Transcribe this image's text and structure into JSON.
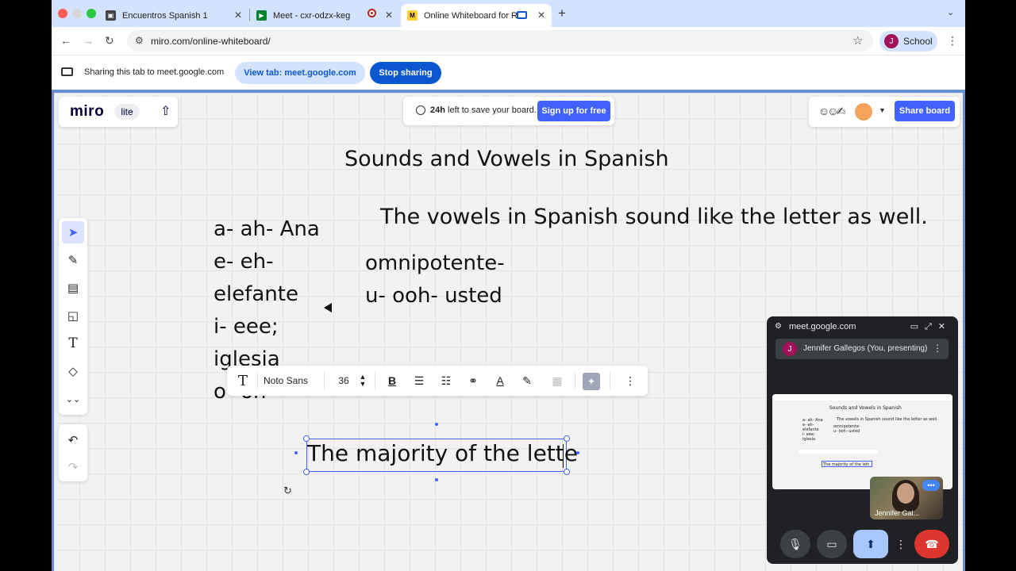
{
  "browser": {
    "tabs": [
      {
        "title": "Encuentros Spanish 1"
      },
      {
        "title": "Meet - cxr-odzx-keg"
      },
      {
        "title": "Online Whiteboard for Re"
      }
    ],
    "new_tab": "+",
    "tab_menu": "⌄",
    "url": "miro.com/online-whiteboard/",
    "profile_initial": "J",
    "profile_label": "School"
  },
  "sharebar": {
    "message": "Sharing this tab to meet.google.com",
    "view_tab": "View tab: meet.google.com",
    "stop_sharing": "Stop sharing"
  },
  "miro": {
    "logo": "miro",
    "badge": "lite",
    "save_bold": "24h",
    "save_rest": " left to save your board.",
    "signup": "Sign up for free",
    "share_board": "Share board",
    "text_toolbar": {
      "font": "Noto Sans",
      "size": "36"
    }
  },
  "board": {
    "heading": "Sounds and Vowels in Spanish",
    "sentence": "The vowels in Spanish sound like the letter as well.",
    "vowels": [
      "a- ah- Ana",
      "e- eh-",
      "elefante",
      "i- eee;",
      "iglesia",
      "o- oh"
    ],
    "omni": [
      "omnipotente-",
      "u- ooh- usted"
    ],
    "editing_text": "The majority of the lette"
  },
  "meet": {
    "domain": "meet.google.com",
    "presenter_initial": "J",
    "presenter": "Jennifer Gallegos (You, presenting)",
    "self_name": "Jennifer Gal...",
    "mini": {
      "heading": "Sounds and Vowels in Spanish",
      "sentence": "The vowels in Spanish sound like the letter as well.",
      "vowels": "a- ah- Ana\ne- eh-\nelefante\ni- eee;\niglesia",
      "omni": "omnipotente-\nu- ooh- usted",
      "editing": "The majority of the lett"
    }
  },
  "colors": {
    "miro_blue": "#4262ff",
    "chrome_blue": "#0b57d0",
    "end_call": "#dc362e"
  }
}
